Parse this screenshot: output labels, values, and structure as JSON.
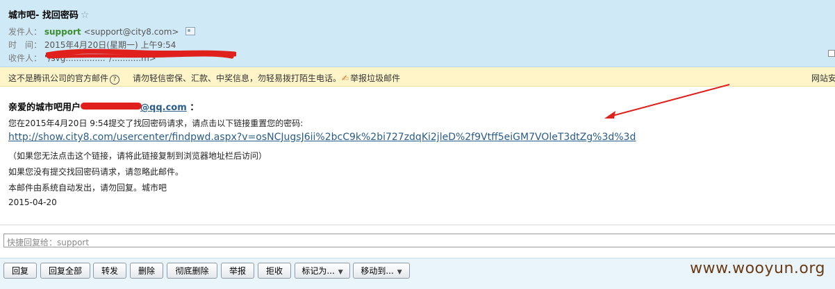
{
  "header": {
    "subject": "城市吧- 找回密码",
    "sender_label": "发件人：",
    "sender_name": "support",
    "sender_email": "<support@city8.com>",
    "time_label": "时　间：",
    "time_value": "2015年4月20日(星期一) 上午9:54",
    "recipient_label": "收件人：",
    "recipient_value": "\"/svg...............\"/...........m>"
  },
  "warning": {
    "not_official": "这不是腾讯公司的官方邮件",
    "help_symbol": "?",
    "tip": "请勿轻信密保、汇款、中奖信息，勿轻易拨打陌生电话。",
    "report": "举报垃圾邮件",
    "security": "网站安"
  },
  "body": {
    "greeting_prefix": "亲爱的城市吧用户",
    "greeting_email": "@qq.com",
    "greeting_suffix": "：",
    "line1": "您在2015年4月20日 9:54提交了找回密码请求，请点击以下链接重置您的密码:",
    "link": "http://show.city8.com/usercenter/findpwd.aspx?v=osNCJugsJ6ii%2bcC9k%2bi727zdqKi2jleD%2f9Vtff5eiGM7VOleT3dtZg%3d%3d",
    "line2": "（如果您无法点击这个链接，请将此链接复制到浏览器地址栏后访问）",
    "line3": "如果您没有提交找回密码请求，请忽略此邮件。",
    "line4": "本邮件由系统自动发出，请勿回复。城市吧",
    "date": "2015-04-20"
  },
  "quick_reply": {
    "placeholder": "快捷回复给：support"
  },
  "toolbar": {
    "reply": "回复",
    "reply_all": "回复全部",
    "forward": "转发",
    "delete": "删除",
    "delete_permanent": "彻底删除",
    "report": "举报",
    "reject": "拒收",
    "mark_as": "标记为...",
    "move_to": "移动到..."
  },
  "watermark": "www.wooyun.org",
  "colors": {
    "header_bg": "#cfe9f7",
    "warning_bg": "#fff5c8",
    "link": "#2a5c8a",
    "redaction": "#e0201c"
  }
}
